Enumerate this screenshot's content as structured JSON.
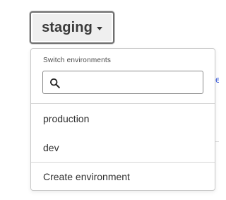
{
  "environment_switcher": {
    "current": "staging",
    "caret_icon": "caret-down-icon"
  },
  "dropdown": {
    "section_label": "Switch environments",
    "search": {
      "icon": "search-icon",
      "value": "",
      "placeholder": ""
    },
    "items": [
      {
        "label": "production"
      },
      {
        "label": "dev"
      }
    ],
    "create_label": "Create environment"
  },
  "colors": {
    "button_bg": "#efefef",
    "button_border": "#6f6f6f",
    "link": "#3b5bdb",
    "divider": "#d6d6d6"
  }
}
